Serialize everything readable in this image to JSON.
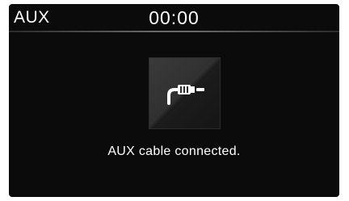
{
  "status_bar": {
    "source": "AUX",
    "time": "00:00"
  },
  "main": {
    "icon": "aux-cable-icon",
    "message": "AUX cable connected."
  },
  "colors": {
    "background": "#0b0b0b",
    "text": "#ffffff",
    "tile": "#2e2e2e"
  }
}
